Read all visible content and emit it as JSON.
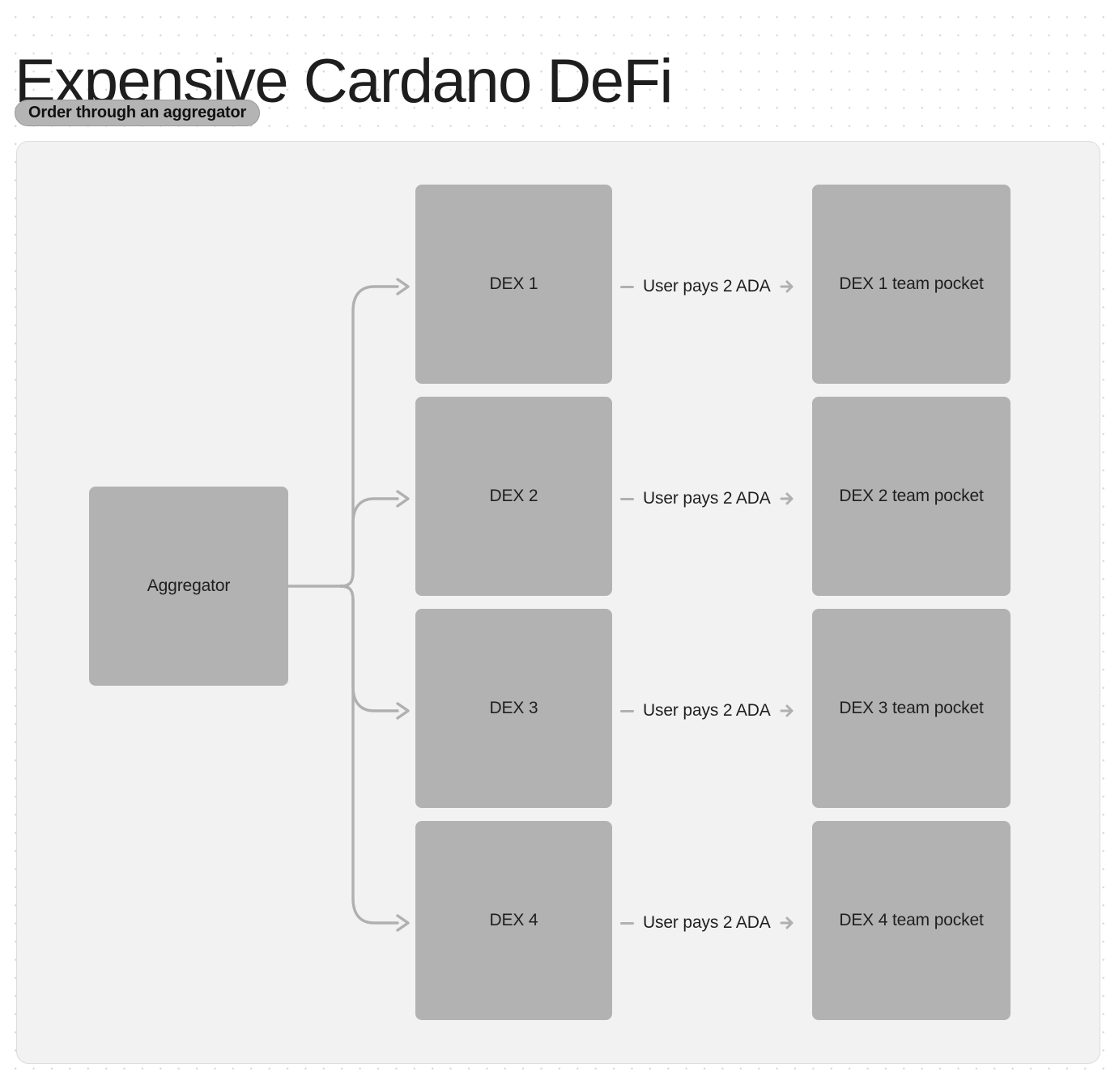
{
  "header": {
    "title": "Expensive Cardano DeFi",
    "badge": "Order through an aggregator"
  },
  "colors": {
    "node_fill": "#b2b2b2",
    "canvas_bg": "#f2f2f2",
    "canvas_border": "#dcdcdc",
    "edge_stroke": "#b0b0b0",
    "text": "#1f1f1f",
    "title_text": "#1e1e1e",
    "badge_bg": "#b4b4b4",
    "dot_grid": "#d8d8d8"
  },
  "diagram": {
    "source": {
      "id": "aggregator",
      "label": "Aggregator"
    },
    "rows": [
      {
        "dex": "DEX 1",
        "edge_label": "User pays 2 ADA",
        "pocket": "DEX 1 team pocket"
      },
      {
        "dex": "DEX 2",
        "edge_label": "User pays 2 ADA",
        "pocket": "DEX 2 team pocket"
      },
      {
        "dex": "DEX 3",
        "edge_label": "User pays 2 ADA",
        "pocket": "DEX 3 team pocket"
      },
      {
        "dex": "DEX 4",
        "edge_label": "User pays 2 ADA",
        "pocket": "DEX 4 team pocket"
      }
    ]
  }
}
